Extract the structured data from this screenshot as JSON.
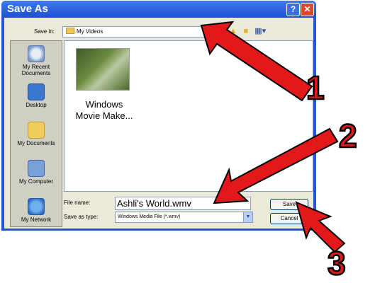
{
  "window": {
    "title": "Save As",
    "help_label": "?",
    "close_label": "✕"
  },
  "toolbar": {
    "save_in_label": "Save in:",
    "save_in_value": "My Videos",
    "icons": [
      "back-icon",
      "up-folder-icon",
      "new-folder-icon",
      "views-menu-icon"
    ]
  },
  "places": [
    {
      "label": "My Recent Documents",
      "icon": "recent-documents-icon"
    },
    {
      "label": "Desktop",
      "icon": "desktop-icon"
    },
    {
      "label": "My Documents",
      "icon": "my-documents-icon"
    },
    {
      "label": "My Computer",
      "icon": "my-computer-icon"
    },
    {
      "label": "My Network",
      "icon": "my-network-icon"
    }
  ],
  "files": [
    {
      "label_line1": "Windows",
      "label_line2": "Movie Make..."
    }
  ],
  "form": {
    "file_name_label": "File name:",
    "file_name_value": "Ashli's World.wmv",
    "save_as_type_label": "Save as type:",
    "save_as_type_value": "Windows Media File (*.wmv)"
  },
  "buttons": {
    "save": "Save",
    "cancel": "Cancel"
  },
  "callouts": [
    "1",
    "2",
    "3"
  ],
  "colors": {
    "title_bar": "#2654d6",
    "dialog_face": "#ece9d8",
    "annotation_red": "#e3181a"
  }
}
